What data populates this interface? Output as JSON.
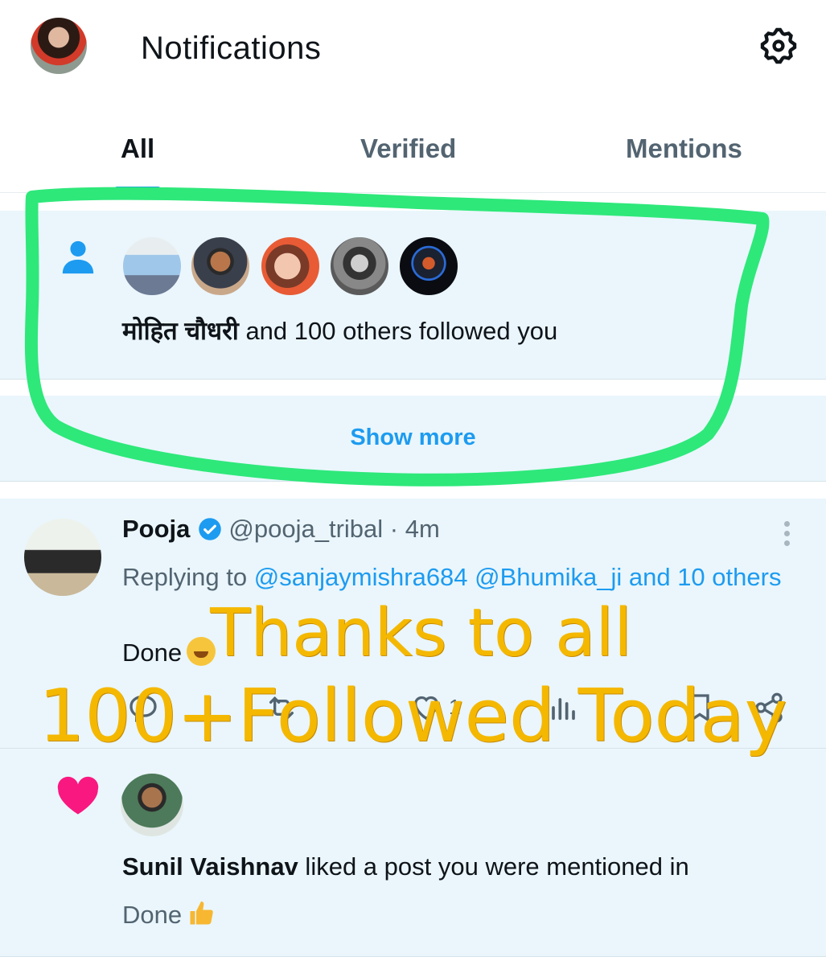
{
  "header": {
    "title": "Notifications"
  },
  "tabs": [
    {
      "label": "All",
      "active": true
    },
    {
      "label": "Verified",
      "active": false
    },
    {
      "label": "Mentions",
      "active": false
    }
  ],
  "follow_notification": {
    "name": "मोहित चौधरी",
    "text": " and 100 others followed you",
    "show_more": "Show more"
  },
  "reply_post": {
    "name": "Pooja",
    "handle": "@pooja_tribal · 4m",
    "replying_prefix": "Replying to ",
    "replying_links": "@sanjaymishra684 @Bhumika_ji and 10 others",
    "body": "Done",
    "like_count": "1"
  },
  "overlay_text": {
    "line1": "Thanks to all",
    "line2": "100+Followed Today"
  },
  "like_notification": {
    "name": "Sunil Vaishnav",
    "text": " liked a post you were mentioned in",
    "body": "Done"
  },
  "colors": {
    "accent": "#1d9bf0",
    "card_bg": "#eaf6fc",
    "highlight": "#2ee87a",
    "overlay": "#f5b800",
    "heart": "#f91880"
  }
}
